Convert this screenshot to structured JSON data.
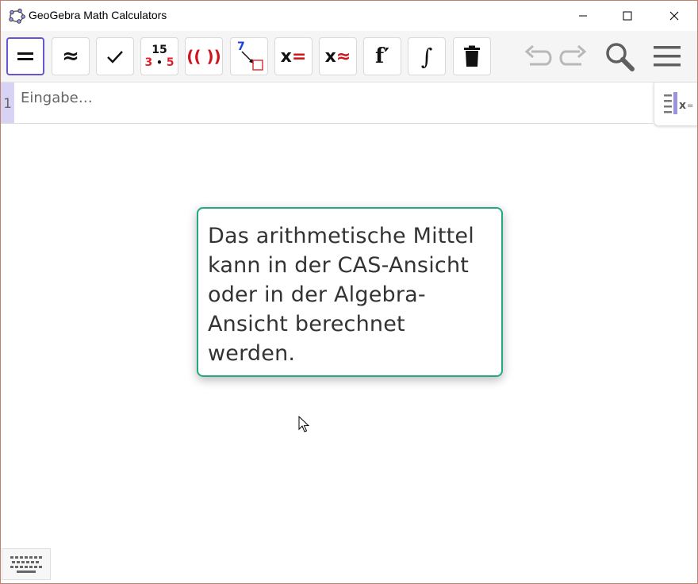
{
  "window": {
    "title": "GeoGebra Math Calculators"
  },
  "toolbar": {
    "tools": [
      {
        "name": "evaluate",
        "icon": "equals-icon",
        "label": "="
      },
      {
        "name": "numeric",
        "icon": "approx-icon",
        "label": "≈"
      },
      {
        "name": "keep-input",
        "icon": "checkmark-icon",
        "label": "✓"
      },
      {
        "name": "factor",
        "icon": "factor-icon",
        "top": "15",
        "bottom_left": "3",
        "bottom_right": "5"
      },
      {
        "name": "expand",
        "icon": "expand-icon",
        "label": "(( ))"
      },
      {
        "name": "substitute",
        "icon": "substitute-icon",
        "label": "7"
      },
      {
        "name": "solve",
        "icon": "solve-icon",
        "label_x": "x",
        "label_op": "="
      },
      {
        "name": "solve-numerically",
        "icon": "solve-numeric-icon",
        "label_x": "x",
        "label_op": "≈"
      },
      {
        "name": "derivative",
        "icon": "derivative-icon",
        "label": "f′"
      },
      {
        "name": "integral",
        "icon": "integral-icon",
        "label": "∫"
      },
      {
        "name": "delete",
        "icon": "trash-icon"
      }
    ]
  },
  "algebra": {
    "row_number": "1",
    "input_placeholder": "Eingabe…",
    "input_value": ""
  },
  "tooltip": {
    "text": "Das arithmetische Mittel kann in der CAS-Ansicht oder in der Algebra-Ansicht berechnet werden."
  },
  "colors": {
    "accent": "#6557d2",
    "tooltip_border": "#22a883",
    "factor_red": "#e0232d",
    "expand_red": "#d0141c",
    "substitute_blue": "#1a3ddd",
    "row_marker": "#d8d3f5"
  }
}
